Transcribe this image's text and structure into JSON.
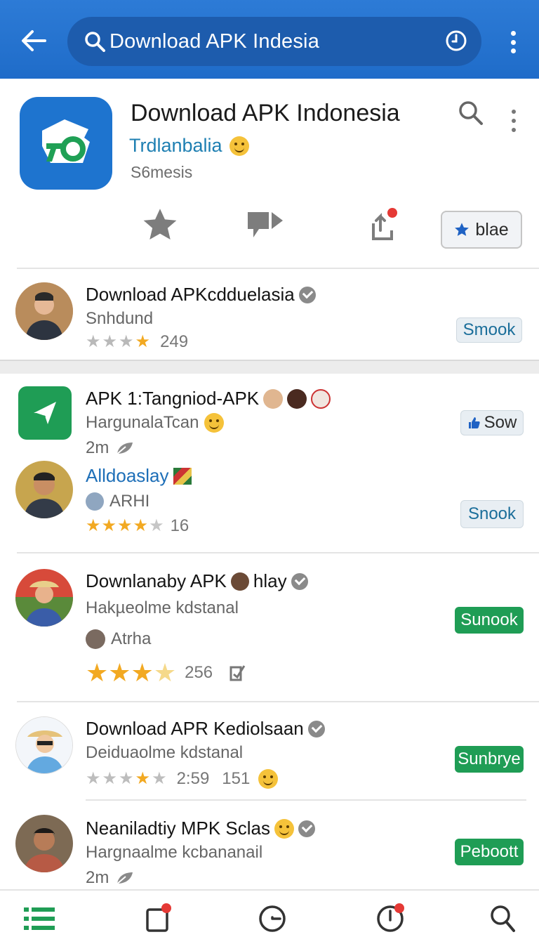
{
  "search": {
    "query": "Download APK Indesia"
  },
  "app": {
    "title": "Download APK Indonesia",
    "developer": "Trdlanbalia",
    "subtitle": "S6mesis",
    "action_button": "blae"
  },
  "featured": {
    "name": "Download APKcdduelasia",
    "meta": "Snhdund",
    "rating_count": "249",
    "button": "Smook"
  },
  "list": [
    {
      "name": "APK 1:Tangniod-APK",
      "meta": "HargunalaTcan",
      "time": "2m",
      "button": "Sow"
    },
    {
      "name": "Alldoaslay",
      "meta": "ARHI",
      "rating_count": "16",
      "button": "Snook"
    },
    {
      "name": "Downlanaby APK",
      "name_suffix": "hlay",
      "meta": "Hakµeolme kdstanal",
      "author": "Atrha",
      "rating_count": "256",
      "button": "Sunook"
    },
    {
      "name": "Download APR Kediolsaan",
      "meta": "Deiduaolme kdstanal",
      "time": "2:59",
      "rating_count": "151",
      "button": "Sunbrye"
    },
    {
      "name": "Neaniladtiy MPK Sclas",
      "meta": "Hargnaalme kcbananail",
      "time": "2m",
      "button": "Peboott"
    }
  ],
  "colors": {
    "header": "#1f6cc9",
    "accent_green": "#1f9d55",
    "star": "#f2a922"
  }
}
